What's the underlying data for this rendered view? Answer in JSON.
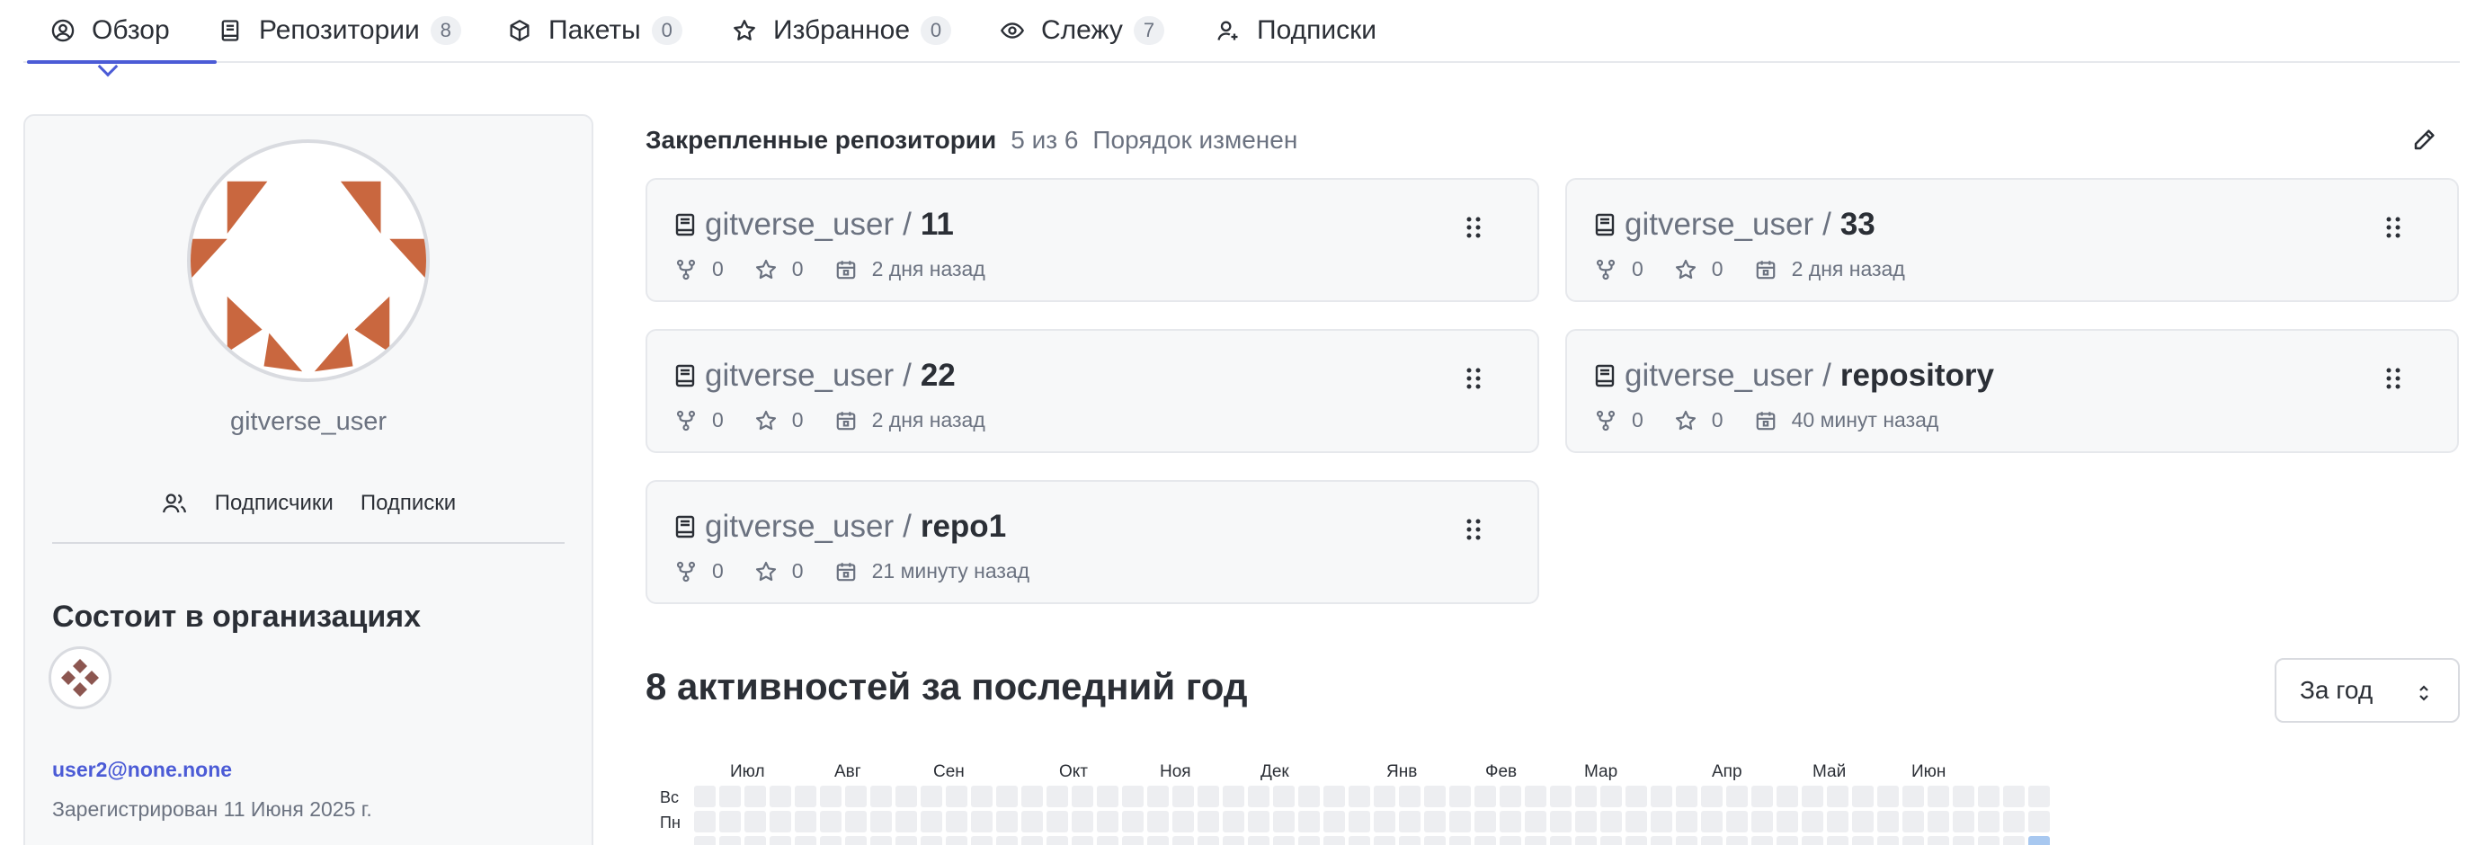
{
  "tabs": [
    {
      "label": "Обзор",
      "icon": "user-circle-icon",
      "active": true
    },
    {
      "label": "Репозитории",
      "icon": "book-icon",
      "count": "8"
    },
    {
      "label": "Пакеты",
      "icon": "package-icon",
      "count": "0"
    },
    {
      "label": "Избранное",
      "icon": "star-icon",
      "count": "0"
    },
    {
      "label": "Слежу",
      "icon": "eye-icon",
      "count": "7"
    },
    {
      "label": "Подписки",
      "icon": "user-plus-icon"
    }
  ],
  "profile": {
    "username": "gitverse_user",
    "followers_label": "Подписчики",
    "following_label": "Подписки",
    "orgs_title": "Состоит в организациях",
    "email": "user2@none.none",
    "registered": "Зарегистрирован 11 Июня 2025 г."
  },
  "pinned": {
    "title": "Закрепленные репозитории",
    "count": "5 из 6",
    "status": "Порядок изменен",
    "repos": [
      {
        "owner": "gitverse_user",
        "sep": "/",
        "name": "11",
        "forks": "0",
        "stars": "0",
        "updated": "2 дня назад"
      },
      {
        "owner": "gitverse_user",
        "sep": "/",
        "name": "33",
        "forks": "0",
        "stars": "0",
        "updated": "2 дня назад"
      },
      {
        "owner": "gitverse_user",
        "sep": "/",
        "name": "22",
        "forks": "0",
        "stars": "0",
        "updated": "2 дня назад"
      },
      {
        "owner": "gitverse_user",
        "sep": "/",
        "name": "repository",
        "forks": "0",
        "stars": "0",
        "updated": "40 минут назад"
      },
      {
        "owner": "gitverse_user",
        "sep": "/",
        "name": "repo1",
        "forks": "0",
        "stars": "0",
        "updated": "21 минуту назад"
      }
    ]
  },
  "activity": {
    "title": "8 активностей за последний год",
    "period": "За год",
    "months": [
      "Июл",
      "Авг",
      "Сен",
      "Окт",
      "Ноя",
      "Дек",
      "Янв",
      "Фев",
      "Мар",
      "Апр",
      "Май",
      "Июн"
    ],
    "days": [
      "Вс",
      "Пн"
    ]
  },
  "colors": {
    "accent": "#4b5bd6",
    "avatar": "#c9673f",
    "contribution": "#a8c8f0"
  }
}
